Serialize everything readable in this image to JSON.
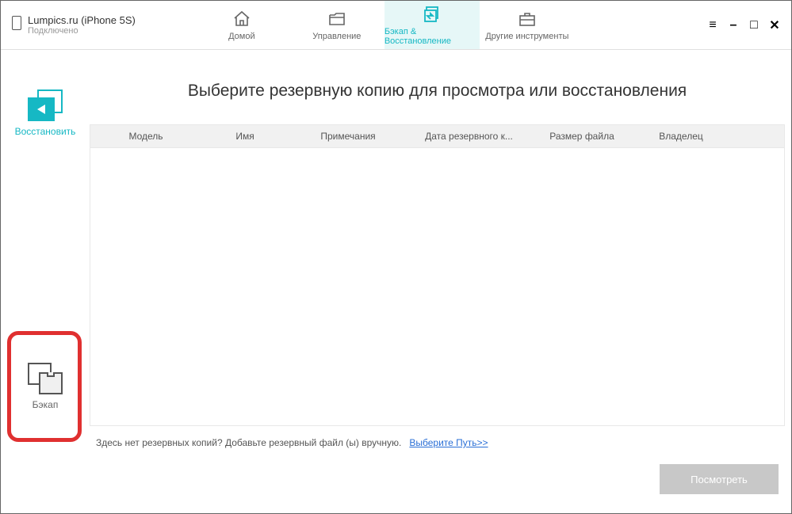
{
  "device": {
    "name": "Lumpics.ru (iPhone 5S)",
    "status": "Подключено"
  },
  "tabs": {
    "home": "Домой",
    "manage": "Управление",
    "backup_restore": "Бэкап & Восстановление",
    "other": "Другие инструменты"
  },
  "sidebar": {
    "restore": "Восстановить",
    "backup": "Бэкап"
  },
  "page_title": "Выберите резервную копию для просмотра или восстановления",
  "columns": {
    "model": "Модель",
    "name": "Имя",
    "notes": "Примечания",
    "date": "Дата резервного к...",
    "size": "Размер файла",
    "owner": "Владелец"
  },
  "footer": {
    "text": "Здесь нет резервных копий? Добавьте резервный файл (ы) вручную.",
    "link": "Выберите Путь>>"
  },
  "view_button": "Посмотреть"
}
